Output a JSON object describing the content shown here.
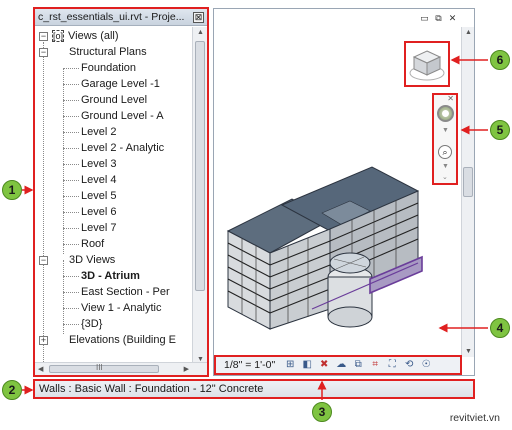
{
  "browser": {
    "title": "c_rst_essentials_ui.rvt - Proje...",
    "close_glyph": "⊠",
    "root_label": "Views (all)",
    "tree": [
      {
        "label": "Structural Plans",
        "level": 1,
        "expander": "−"
      },
      {
        "label": "Foundation",
        "level": 2
      },
      {
        "label": "Garage Level  -1",
        "level": 2
      },
      {
        "label": "Ground Level",
        "level": 2
      },
      {
        "label": "Ground Level - A",
        "level": 2
      },
      {
        "label": "Level 2",
        "level": 2
      },
      {
        "label": "Level 2 - Analytic",
        "level": 2
      },
      {
        "label": "Level 3",
        "level": 2
      },
      {
        "label": "Level 4",
        "level": 2
      },
      {
        "label": "Level 5",
        "level": 2
      },
      {
        "label": "Level 6",
        "level": 2
      },
      {
        "label": "Level 7",
        "level": 2
      },
      {
        "label": "Roof",
        "level": 2
      },
      {
        "label": "3D Views",
        "level": 1,
        "expander": "−"
      },
      {
        "label": "3D - Atrium",
        "level": 2,
        "bold": true
      },
      {
        "label": "East Section - Per",
        "level": 2
      },
      {
        "label": "View 1 - Analytic",
        "level": 2
      },
      {
        "label": "{3D}",
        "level": 2
      },
      {
        "label": "Elevations (Building E",
        "level": 1,
        "expander": "+"
      }
    ],
    "hscroll_grip": "III"
  },
  "canvas": {
    "window_controls": [
      "▭",
      "⧉",
      "✕"
    ],
    "scale": "1/8\" = 1'-0\"",
    "view_control_icons": [
      "grid-icon",
      "cube-icon",
      "hide-icon",
      "sun-path-icon",
      "crop-icon",
      "crop-hide-icon",
      "reveal-icon",
      "analytical-icon",
      "lightbulb-icon"
    ]
  },
  "statusbar": {
    "text": "Walls : Basic Wall : Foundation - 12\" Concrete"
  },
  "callouts": [
    "1",
    "2",
    "3",
    "4",
    "5",
    "6"
  ],
  "watermark": "revitviet.vn",
  "colors": {
    "highlight": "#e02020",
    "callout_fill": "#7fc441",
    "building_roof": "#5d6d7e",
    "selection": "#6a3d9a"
  }
}
